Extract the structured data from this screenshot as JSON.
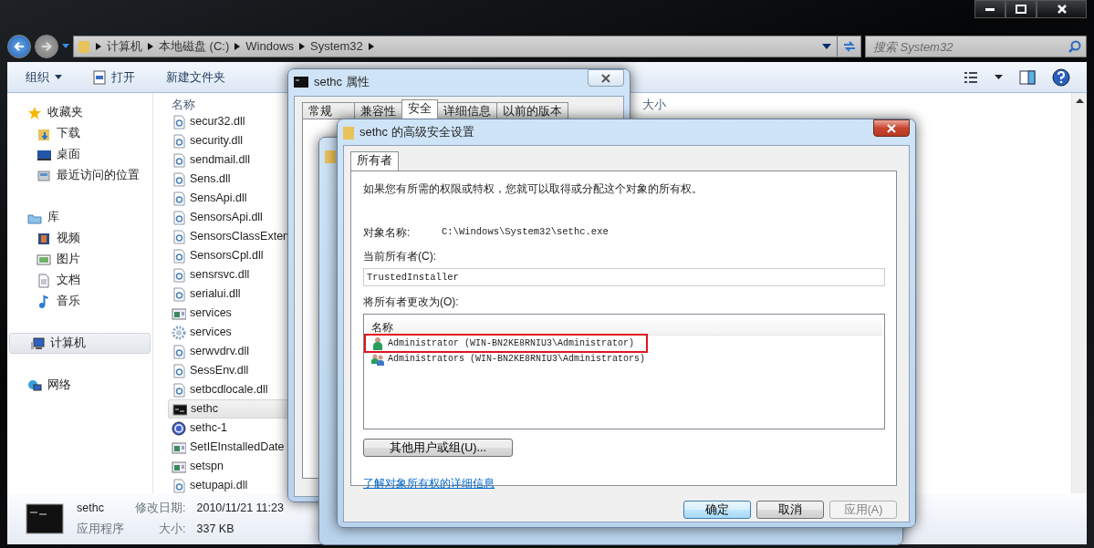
{
  "address_bar": {
    "crumbs": [
      "计算机",
      "本地磁盘 (C:)",
      "Windows",
      "System32"
    ]
  },
  "search": {
    "placeholder": "搜索 System32"
  },
  "toolbar": {
    "items": [
      {
        "label": "组织",
        "kind": "menu"
      },
      {
        "label": "打开",
        "kind": "open"
      },
      {
        "label": "新建文件夹",
        "kind": "plain"
      }
    ]
  },
  "nav": [
    {
      "label": "收藏夹",
      "kind": "star",
      "selected": false,
      "children": [
        {
          "label": "下载",
          "kind": "download",
          "selected": false
        },
        {
          "label": "桌面",
          "kind": "desktop",
          "selected": false
        },
        {
          "label": "最近访问的位置",
          "kind": "recent",
          "selected": false
        }
      ]
    },
    {
      "label": "库",
      "kind": "library",
      "selected": false,
      "children": [
        {
          "label": "视频",
          "kind": "video",
          "selected": false
        },
        {
          "label": "图片",
          "kind": "image",
          "selected": false
        },
        {
          "label": "文档",
          "kind": "doc",
          "selected": false
        },
        {
          "label": "音乐",
          "kind": "music",
          "selected": false
        }
      ]
    },
    {
      "label": "计算机",
      "kind": "computer",
      "selected": true
    },
    {
      "label": "网络",
      "kind": "network",
      "selected": false
    }
  ],
  "files": {
    "columns": [
      "名称",
      "大小"
    ],
    "rows": [
      {
        "name": "secur32.dll",
        "kind": "dll",
        "selected": false
      },
      {
        "name": "security.dll",
        "kind": "dll",
        "selected": false
      },
      {
        "name": "sendmail.dll",
        "kind": "dll",
        "selected": false
      },
      {
        "name": "Sens.dll",
        "kind": "dll",
        "selected": false
      },
      {
        "name": "SensApi.dll",
        "kind": "dll",
        "selected": false
      },
      {
        "name": "SensorsApi.dll",
        "kind": "dll",
        "selected": false
      },
      {
        "name": "SensorsClassExten",
        "kind": "dll",
        "selected": false
      },
      {
        "name": "SensorsCpl.dll",
        "kind": "dll",
        "selected": false
      },
      {
        "name": "sensrsvc.dll",
        "kind": "dll",
        "selected": false
      },
      {
        "name": "serialui.dll",
        "kind": "dll",
        "selected": false
      },
      {
        "name": "services",
        "kind": "msc",
        "selected": false
      },
      {
        "name": "services",
        "kind": "gear",
        "selected": false
      },
      {
        "name": "serwvdrv.dll",
        "kind": "dll",
        "selected": false
      },
      {
        "name": "SessEnv.dll",
        "kind": "dll",
        "selected": false
      },
      {
        "name": "setbcdlocale.dll",
        "kind": "dll",
        "selected": false
      },
      {
        "name": "sethc",
        "kind": "cmd",
        "selected": true
      },
      {
        "name": "sethc-1",
        "kind": "globe",
        "selected": false
      },
      {
        "name": "SetIEInstalledDate",
        "kind": "msc",
        "selected": false
      },
      {
        "name": "setspn",
        "kind": "msc",
        "selected": false
      },
      {
        "name": "setupapi.dll",
        "kind": "dll",
        "selected": false
      }
    ]
  },
  "details": {
    "name": "sethc",
    "type": "应用程序",
    "modified_label": "修改日期:",
    "modified": "2010/11/21 11:23",
    "size_label": "大小:",
    "size": "337 KB"
  },
  "properties_dialog": {
    "title": "sethc 属性",
    "tabs": [
      {
        "label": "常规",
        "selected": false
      },
      {
        "label": "兼容性",
        "selected": false
      },
      {
        "label": "安全",
        "selected": true
      },
      {
        "label": "详细信息",
        "selected": false
      },
      {
        "label": "以前的版本",
        "selected": false
      }
    ]
  },
  "advanced_dialog": {
    "title": "sethc 的高级安全设置",
    "tabs": [
      {
        "label": "所有者",
        "selected": true
      }
    ],
    "intro": "如果您有所需的权限或特权，您就可以取得或分配这个对象的所有权。",
    "object_label": "对象名称:",
    "object_value": "C:\\Windows\\System32\\sethc.exe",
    "current_owner_label": "当前所有者(C):",
    "current_owner": "TrustedInstaller",
    "change_label": "将所有者更改为(O):",
    "list_column": "名称",
    "owners": [
      {
        "name": "Administrator (WIN-BN2KE8RNIU3\\Administrator)",
        "kind": "user",
        "highlighted": true
      },
      {
        "name": "Administrators (WIN-BN2KE8RNIU3\\Administrators)",
        "kind": "group",
        "highlighted": false
      }
    ],
    "other_button": "其他用户或组(U)...",
    "link": "了解对象所有权的详细信息",
    "buttons": [
      {
        "label": "确定",
        "kind": "default",
        "disabled": false
      },
      {
        "label": "取消",
        "kind": "normal",
        "disabled": false
      },
      {
        "label": "应用(A)",
        "kind": "normal",
        "disabled": true
      }
    ]
  }
}
